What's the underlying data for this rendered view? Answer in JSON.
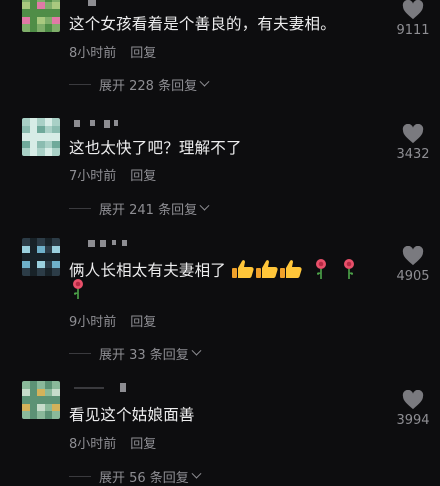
{
  "comments": [
    {
      "text": "这个女孩看着是个善良的，有夫妻相。",
      "time": "8小时前",
      "reply_label": "回复",
      "expand_label": "展开 228 条回复",
      "likes": "9111",
      "avatar_colors": [
        "#7fae6a",
        "#e07aa6",
        "#4f8d47",
        "#a9c97f"
      ]
    },
    {
      "text": "这也太快了吧？理解不了",
      "time": "7小时前",
      "reply_label": "回复",
      "expand_label": "展开 241 条回复",
      "likes": "3432",
      "avatar_colors": [
        "#a9d0c6",
        "#6fa99a",
        "#d7ece6",
        "#8bbcb0"
      ]
    },
    {
      "text": "俩人长相太有夫妻相了",
      "text_line2": "",
      "emojis": [
        "thumbs-up",
        "thumbs-up",
        "thumbs-up",
        "rose",
        "rose",
        "rose"
      ],
      "time": "9小时前",
      "reply_label": "回复",
      "expand_label": "展开 33 条回复",
      "likes": "4905",
      "avatar_colors": [
        "#2c3c47",
        "#6fb0c9",
        "#182228",
        "#9ad0de"
      ]
    },
    {
      "text": "看见这个姑娘面善",
      "time": "8小时前",
      "reply_label": "回复",
      "expand_label": "展开 56 条回复",
      "likes": "3994",
      "avatar_colors": [
        "#8ab99a",
        "#d4b25a",
        "#5c9275",
        "#c7dccb"
      ]
    }
  ],
  "colors": {
    "background": "#0d0d0f",
    "text": "#ededee",
    "secondary": "#8e8e93",
    "heart": "#7a7a7f"
  }
}
